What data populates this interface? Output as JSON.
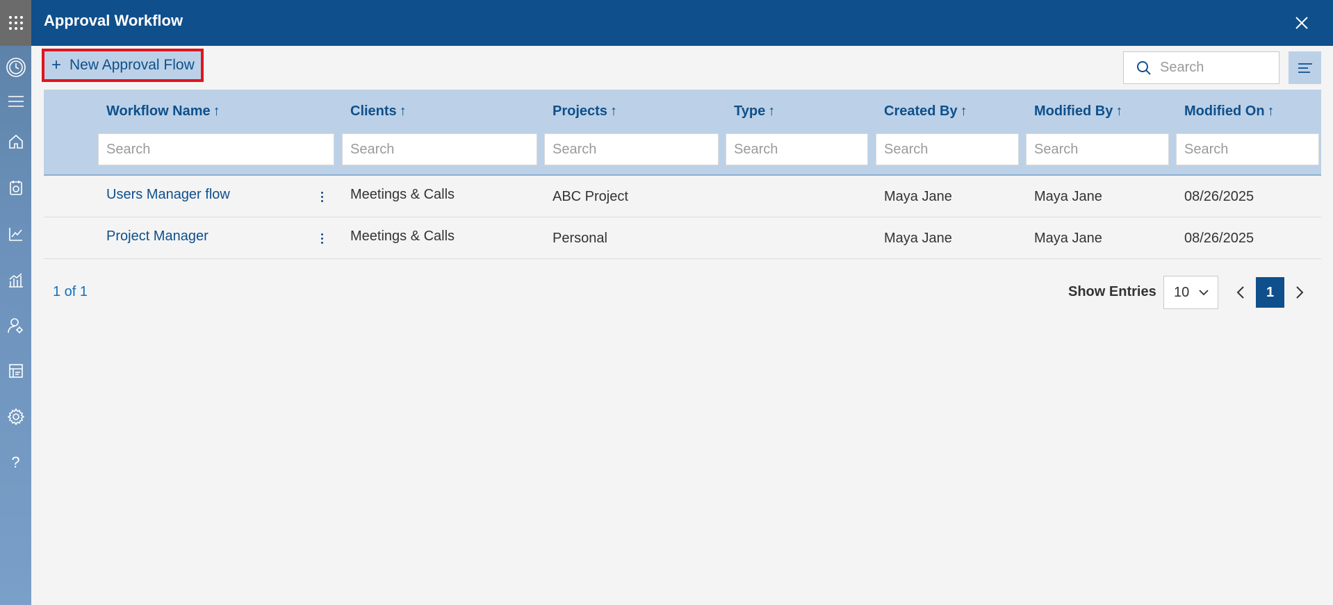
{
  "header": {
    "title": "Approval Workflow"
  },
  "toolbar": {
    "new_label": "New Approval Flow",
    "search_placeholder": "Search"
  },
  "table": {
    "columns": [
      {
        "label": "Workflow Name",
        "arrow": "↑",
        "search": "Search"
      },
      {
        "label": "Clients",
        "arrow": "↑",
        "search": "Search"
      },
      {
        "label": "Projects",
        "arrow": "↑",
        "search": "Search"
      },
      {
        "label": "Type",
        "arrow": "↑",
        "search": "Search"
      },
      {
        "label": "Created By",
        "arrow": "↑",
        "search": "Search"
      },
      {
        "label": "Modified By",
        "arrow": "↑",
        "search": "Search"
      },
      {
        "label": "Modified On",
        "arrow": "↑",
        "search": "Search"
      }
    ],
    "rows": [
      {
        "name": "Users Manager flow",
        "client": "Meetings & Calls",
        "project": "ABC Project",
        "type": "",
        "created_by": "Maya Jane",
        "modified_by": "Maya Jane",
        "modified_on": "08/26/2025"
      },
      {
        "name": "Project Manager",
        "client": "Meetings & Calls",
        "project": "Personal",
        "type": "",
        "created_by": "Maya Jane",
        "modified_by": "Maya Jane",
        "modified_on": "08/26/2025"
      }
    ]
  },
  "pager": {
    "info": "1 of 1",
    "show_entries_label": "Show Entries",
    "entries_value": "10",
    "current_page": "1"
  },
  "sidebar": {
    "icons": [
      "apps-grid-icon",
      "clock-icon",
      "menu-icon",
      "home-icon",
      "timesheet-icon",
      "line-chart-icon",
      "bar-chart-icon",
      "user-settings-icon",
      "report-icon",
      "gear-icon",
      "help-icon"
    ]
  },
  "colors": {
    "header_bg": "#0f4f8b",
    "table_header_bg": "#bcd1e7",
    "highlight_border": "#e0141e",
    "link": "#0f4f8b"
  }
}
